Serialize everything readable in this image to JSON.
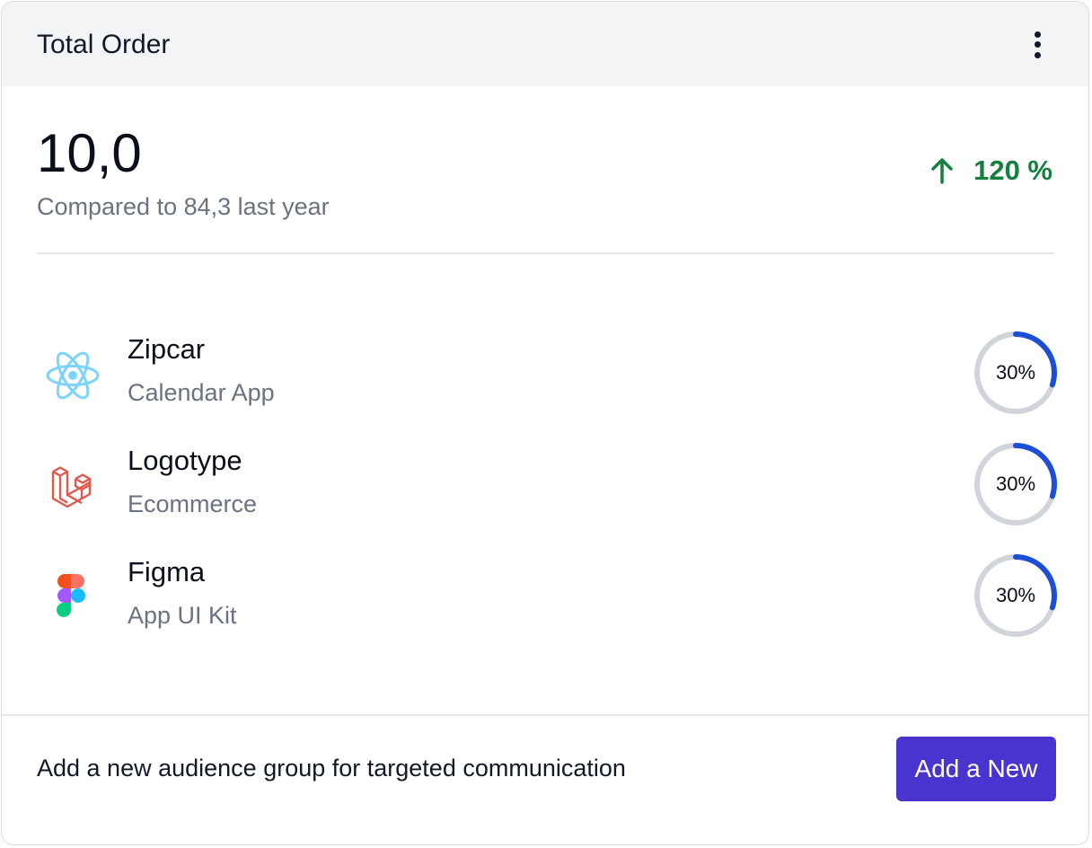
{
  "card": {
    "title": "Total Order",
    "menu_icon": "kebab-vertical-icon"
  },
  "summary": {
    "value": "10,0",
    "comparison": "Compared to 84,3 last year",
    "growth": "120 %",
    "growth_icon": "arrow-up-icon",
    "growth_color": "#15803d"
  },
  "items": [
    {
      "name": "Zipcar",
      "subtitle": "Calendar App",
      "icon": "react-logo-icon",
      "percent_label": "30%",
      "percent": 30
    },
    {
      "name": "Logotype",
      "subtitle": "Ecommerce",
      "icon": "laravel-logo-icon",
      "percent_label": "30%",
      "percent": 30
    },
    {
      "name": "Figma",
      "subtitle": "App UI Kit",
      "icon": "figma-logo-icon",
      "percent_label": "30%",
      "percent": 30
    }
  ],
  "footer": {
    "text": "Add a new audience group for targeted communication",
    "button_label": "Add a New"
  },
  "colors": {
    "accent": "#4a34cf",
    "progress": "#1d4ed8",
    "track": "#d1d5db",
    "header_bg": "#f3f4f6"
  }
}
